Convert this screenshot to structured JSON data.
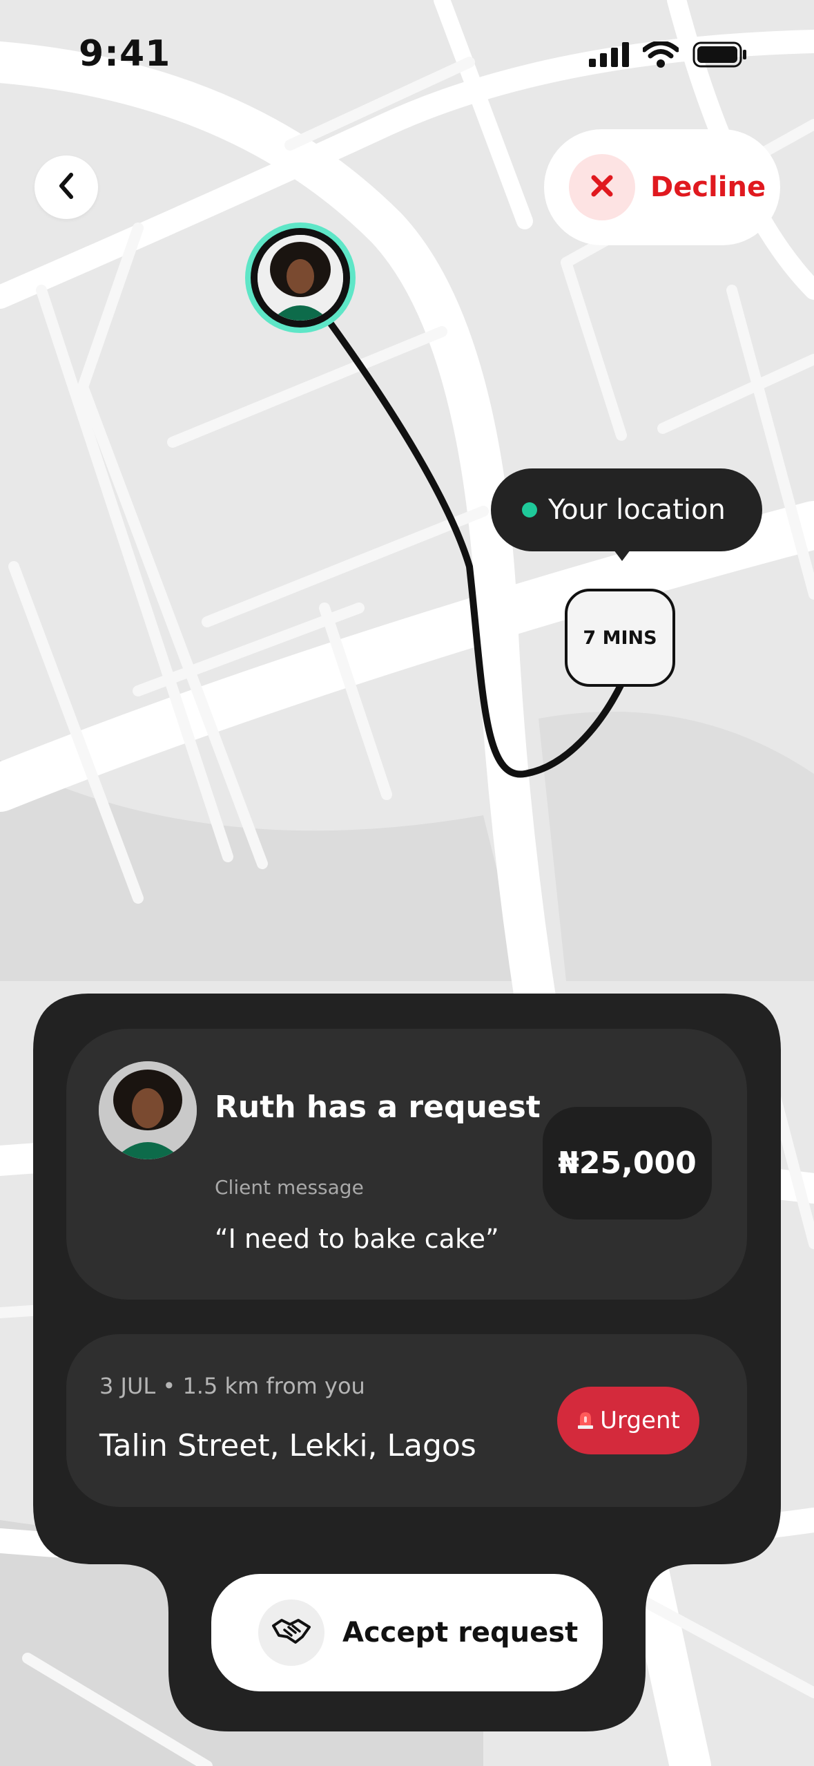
{
  "status_bar": {
    "time": "9:41"
  },
  "top": {
    "decline_label": "Decline"
  },
  "map": {
    "location_label": "Your location",
    "eta": "7 MINS",
    "accent_color": "#5ee6c7",
    "route_color": "#111111"
  },
  "request": {
    "title": "Ruth has a request",
    "message_label": "Client message",
    "message": "“I need to bake cake”",
    "price": "₦25,000"
  },
  "job": {
    "meta": "3 JUL • 1.5 km from you",
    "address": "Talin Street, Lekki, Lagos",
    "urgency": "Urgent",
    "urgency_color": "#d42a3c"
  },
  "actions": {
    "accept_label": "Accept request"
  },
  "icons": {
    "back": "chevron-left-icon",
    "decline": "close-icon",
    "urgent": "siren-icon",
    "accept": "handshake-icon"
  }
}
